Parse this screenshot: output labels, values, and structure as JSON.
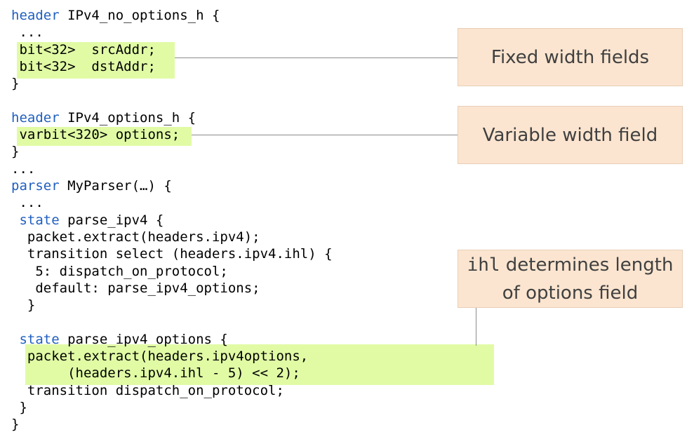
{
  "code": [
    {
      "parts": [
        {
          "text": "header",
          "kw": true
        },
        {
          "text": " IPv4_no_options_h {"
        }
      ]
    },
    {
      "parts": [
        {
          "text": " ..."
        }
      ]
    },
    {
      "parts": [
        {
          "text": " bit<32>  srcAddr;"
        }
      ]
    },
    {
      "parts": [
        {
          "text": " bit<32>  dstAddr;"
        }
      ]
    },
    {
      "parts": [
        {
          "text": "}"
        }
      ]
    },
    {
      "parts": [
        {
          "text": ""
        }
      ]
    },
    {
      "parts": [
        {
          "text": "header",
          "kw": true
        },
        {
          "text": " IPv4_options_h {"
        }
      ]
    },
    {
      "parts": [
        {
          "text": " varbit<320> options;"
        }
      ]
    },
    {
      "parts": [
        {
          "text": "}"
        }
      ]
    },
    {
      "parts": [
        {
          "text": "..."
        }
      ]
    },
    {
      "parts": [
        {
          "text": "parser",
          "kw": true
        },
        {
          "text": " MyParser(…) {"
        }
      ]
    },
    {
      "parts": [
        {
          "text": " ..."
        }
      ]
    },
    {
      "parts": [
        {
          "text": " "
        },
        {
          "text": "state",
          "kw": true
        },
        {
          "text": " parse_ipv4 {"
        }
      ]
    },
    {
      "parts": [
        {
          "text": "  packet.extract(headers.ipv4);"
        }
      ]
    },
    {
      "parts": [
        {
          "text": "  transition select (headers.ipv4.ihl) {"
        }
      ]
    },
    {
      "parts": [
        {
          "text": "   5: dispatch_on_protocol;"
        }
      ]
    },
    {
      "parts": [
        {
          "text": "   default: parse_ipv4_options;"
        }
      ]
    },
    {
      "parts": [
        {
          "text": "  }"
        }
      ]
    },
    {
      "parts": [
        {
          "text": ""
        }
      ]
    },
    {
      "parts": [
        {
          "text": " "
        },
        {
          "text": "state",
          "kw": true
        },
        {
          "text": " parse_ipv4_options {"
        }
      ]
    },
    {
      "parts": [
        {
          "text": "  packet.extract(headers.ipv4options,"
        }
      ]
    },
    {
      "parts": [
        {
          "text": "       (headers.ipv4.ihl - 5) << 2);"
        }
      ]
    },
    {
      "parts": [
        {
          "text": "  transition dispatch_on_protocol;"
        }
      ]
    },
    {
      "parts": [
        {
          "text": " }"
        }
      ]
    },
    {
      "parts": [
        {
          "text": "}"
        }
      ]
    }
  ],
  "callouts": {
    "fixed": {
      "text": "Fixed width fields"
    },
    "variable": {
      "text": "Variable width field"
    },
    "ihl": {
      "mono": "ihl",
      "rest": " determines length",
      "line2": "of options field"
    }
  },
  "colors": {
    "keyword": "#1f5fbf",
    "highlight": "#e1fba5",
    "callout_fill": "#fbe5d0",
    "callout_border": "#e8cfb8",
    "callout_text": "#404040",
    "connector": "#8c8c8c"
  }
}
